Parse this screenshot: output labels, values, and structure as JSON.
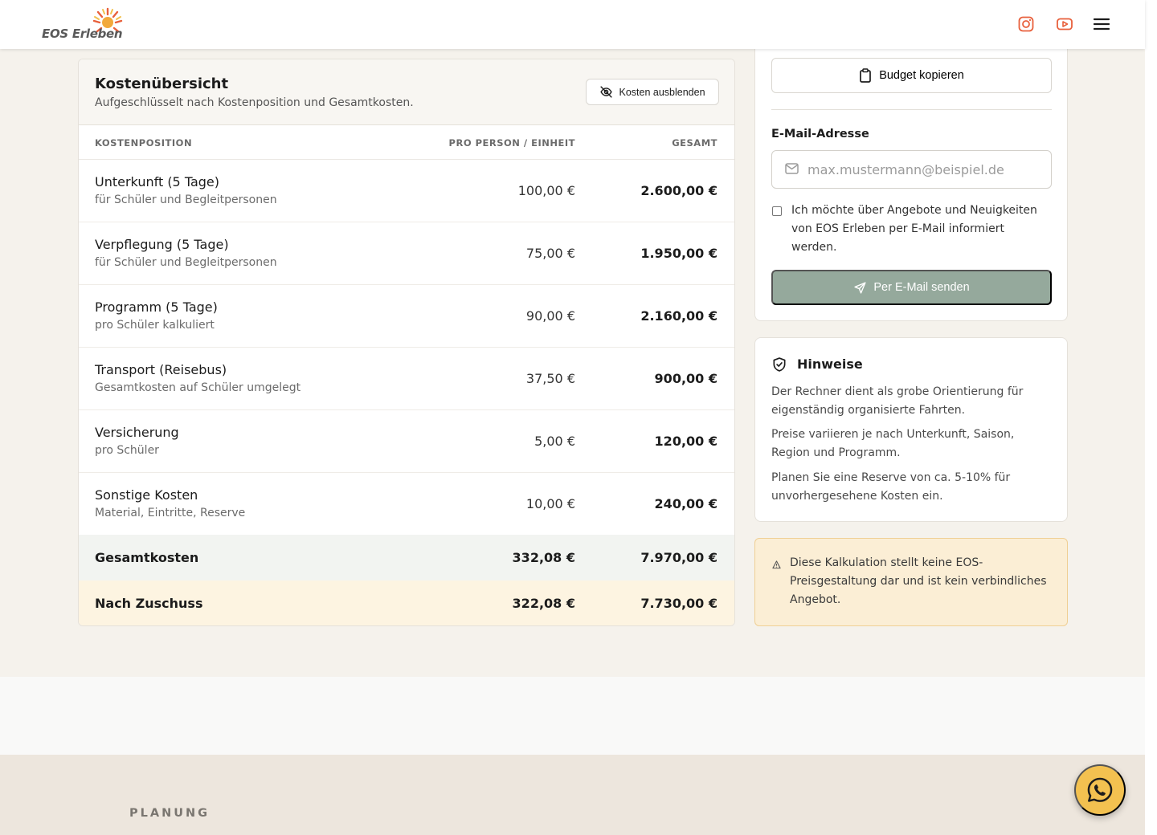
{
  "header": {
    "logo_text": "EOS Erleben",
    "icons": [
      "instagram-icon",
      "youtube-icon",
      "menu-icon"
    ],
    "accent_color": "#e8603c"
  },
  "costs": {
    "title": "Kostenübersicht",
    "subtitle": "Aufgeschlüsselt nach Kostenposition und Gesamtkosten.",
    "hide_button": "Kosten ausblenden",
    "columns": [
      "KOSTENPOSITION",
      "PRO PERSON / EINHEIT",
      "GESAMT"
    ],
    "rows": [
      {
        "name": "Unterkunft (5 Tage)",
        "desc": "für Schüler und Begleitpersonen",
        "per": "100,00 €",
        "total": "2.600,00 €"
      },
      {
        "name": "Verpflegung (5 Tage)",
        "desc": "für Schüler und Begleitpersonen",
        "per": "75,00 €",
        "total": "1.950,00 €"
      },
      {
        "name": "Programm (5 Tage)",
        "desc": "pro Schüler kalkuliert",
        "per": "90,00 €",
        "total": "2.160,00 €"
      },
      {
        "name": "Transport (Reisebus)",
        "desc": "Gesamtkosten auf Schüler umgelegt",
        "per": "37,50 €",
        "total": "900,00 €"
      },
      {
        "name": "Versicherung",
        "desc": "pro Schüler",
        "per": "5,00 €",
        "total": "120,00 €"
      },
      {
        "name": "Sonstige Kosten",
        "desc": "Material, Eintritte, Reserve",
        "per": "10,00 €",
        "total": "240,00 €"
      }
    ],
    "sum": {
      "name": "Gesamtkosten",
      "per": "332,08 €",
      "total": "7.970,00 €"
    },
    "after_subsidy": {
      "name": "Nach Zuschuss",
      "per": "322,08 €",
      "total": "7.730,00 €"
    }
  },
  "send": {
    "copy_button": "Budget kopieren",
    "email_label": "E-Mail-Adresse",
    "email_placeholder": "max.mustermann@beispiel.de",
    "email_value": "",
    "consent_checked": false,
    "consent_text": "Ich möchte über Angebote und Neuigkeiten von EOS Erleben per E-Mail informiert werden.",
    "send_button": "Per E-Mail senden"
  },
  "hints": {
    "title": "Hinweise",
    "paragraphs": [
      "Der Rechner dient als grobe Orientierung für eigenständig organisierte Fahrten.",
      "Preise variieren je nach Unterkunft, Saison, Region und Programm.",
      "Planen Sie eine Reserve von ca. 5-10% für unvorhergesehene Kosten ein."
    ]
  },
  "warning": {
    "text": "Diese Kalkulation stellt keine EOS-Preisgestaltung dar und ist kein verbindliches Angebot."
  },
  "footer": {
    "section_label": "PLANUNG"
  },
  "whatsapp": {
    "icon": "whatsapp-icon",
    "color": "#f3c150"
  }
}
